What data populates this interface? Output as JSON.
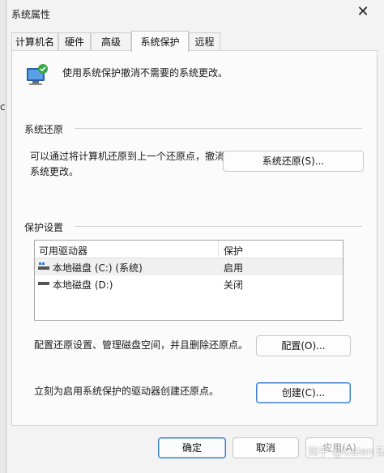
{
  "left_strip_glyph": "ct",
  "window": {
    "title": "系统属性",
    "close_glyph": "✕"
  },
  "tabs": [
    {
      "label": "计算机名",
      "active": false
    },
    {
      "label": "硬件",
      "active": false
    },
    {
      "label": "高级",
      "active": false
    },
    {
      "label": "系统保护",
      "active": true
    },
    {
      "label": "远程",
      "active": false
    }
  ],
  "intro": {
    "text": "使用系统保护撤消不需要的系统更改。",
    "icon": "system-protection-icon"
  },
  "restore": {
    "heading": "系统还原",
    "desc_line1": "可以通过将计算机还原到上一个还原点，撤消",
    "desc_line2": "系统更改。",
    "button": "系统还原(S)..."
  },
  "protection": {
    "heading": "保护设置",
    "columns": [
      "可用驱动器",
      "保护"
    ],
    "drives": [
      {
        "name": "本地磁盘 (C:) (系统)",
        "status": "启用",
        "icon": "system-drive-icon",
        "selected": true
      },
      {
        "name": "本地磁盘 (D:)",
        "status": "关闭",
        "icon": "drive-icon",
        "selected": false
      }
    ],
    "configure_text": "配置还原设置、管理磁盘空间，并且删除还原点。",
    "configure_button": "配置(O)...",
    "create_text": "立刻为启用系统保护的驱动器创建还原点。",
    "create_button": "创建(C)..."
  },
  "footer": {
    "ok": "确定",
    "cancel": "取消",
    "apply": "应用(A)"
  },
  "watermark": "知乎 @Galen EA",
  "colors": {
    "accent": "#3b7ccc",
    "window_bg": "#f3f3f3",
    "panel_bg": "#fbfbfb"
  }
}
